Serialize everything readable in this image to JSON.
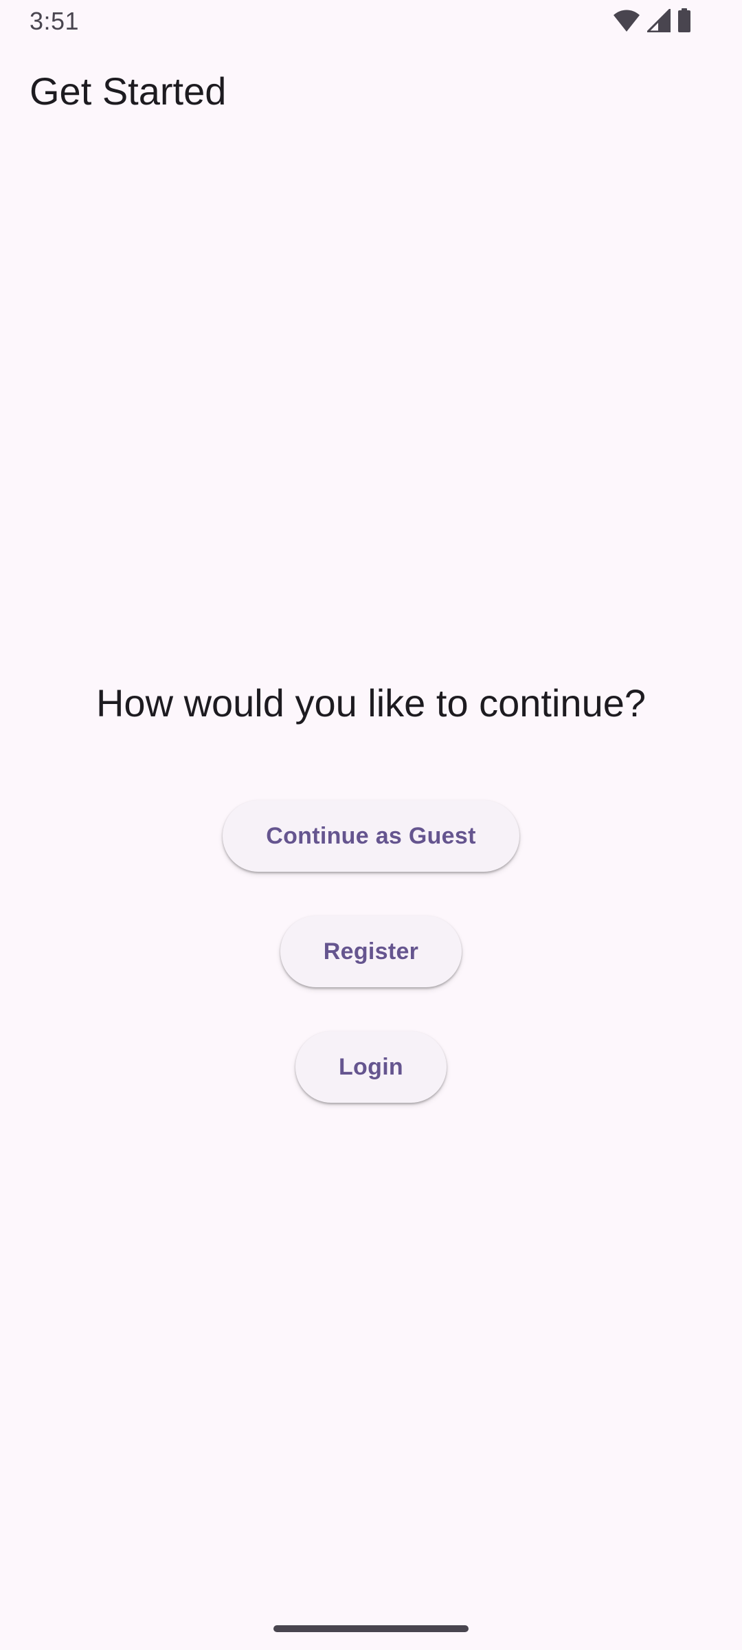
{
  "status_bar": {
    "time": "3:51",
    "icons": [
      "wifi-icon",
      "cell-signal-icon",
      "battery-icon"
    ]
  },
  "app_bar": {
    "title": "Get Started"
  },
  "main": {
    "prompt": "How would you like to continue?",
    "buttons": {
      "guest_label": "Continue as Guest",
      "register_label": "Register",
      "login_label": "Login"
    }
  },
  "colors": {
    "background": "#fdf7fc",
    "button_surface": "#f7f2f8",
    "button_text": "#65558f",
    "text_primary": "#1d1b20"
  }
}
